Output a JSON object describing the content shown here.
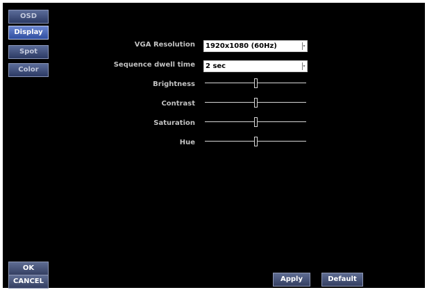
{
  "sidebar": {
    "tabs": [
      {
        "label": "OSD"
      },
      {
        "label": "Display"
      },
      {
        "label": "Spot"
      },
      {
        "label": "Color"
      }
    ],
    "active_tab": "Display",
    "ok_label": "OK",
    "cancel_label": "CANCEL"
  },
  "display": {
    "vga_resolution": {
      "label": "VGA Resolution",
      "value": "1920x1080 (60Hz)"
    },
    "dwell_time": {
      "label": "Sequence dwell time",
      "value": "2 sec"
    },
    "sliders": [
      {
        "label": "Brightness",
        "level": 0.5
      },
      {
        "label": "Contrast",
        "level": 0.5
      },
      {
        "label": "Saturation",
        "level": 0.5
      },
      {
        "label": "Hue",
        "level": 0.5
      }
    ]
  },
  "footer": {
    "apply_label": "Apply",
    "default_label": "Default"
  }
}
